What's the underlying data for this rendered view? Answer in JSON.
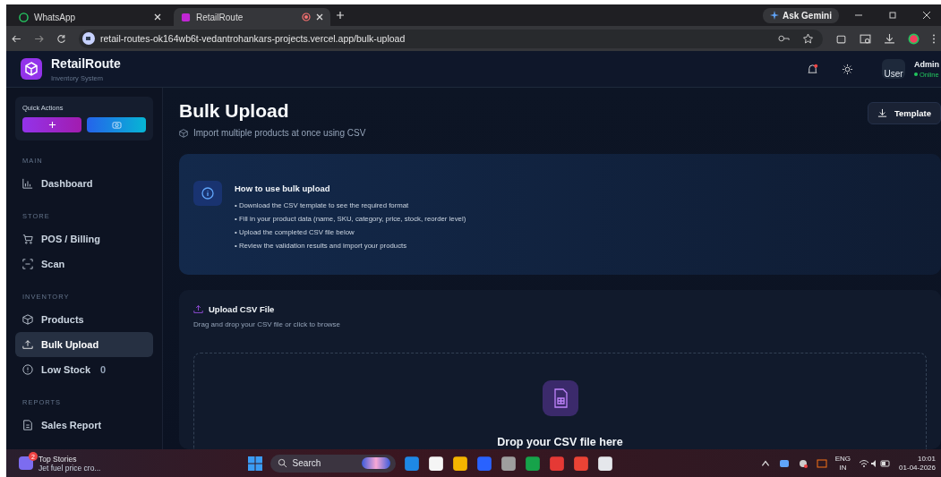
{
  "browser": {
    "tabs": [
      {
        "title": "WhatsApp",
        "selected": false
      },
      {
        "title": "RetailRoute",
        "selected": true
      }
    ],
    "url": "retail-routes-ok164wb6t-vedantrohankars-projects.vercel.app/bulk-upload",
    "gemini": "Ask Gemini"
  },
  "header": {
    "brand": "RetailRoute",
    "subtitle": "Inventory System",
    "user_alt": "User",
    "user_name": "Admin",
    "user_status": "Online",
    "notification": true
  },
  "sidebar": {
    "quick_actions_title": "Quick Actions",
    "sections": [
      {
        "title": "MAIN",
        "items": [
          {
            "label": "Dashboard",
            "selected": false
          }
        ]
      },
      {
        "title": "STORE",
        "items": [
          {
            "label": "POS / Billing",
            "selected": false
          },
          {
            "label": "Scan",
            "selected": false
          }
        ]
      },
      {
        "title": "INVENTORY",
        "items": [
          {
            "label": "Products",
            "selected": false
          },
          {
            "label": "Bulk Upload",
            "selected": true
          },
          {
            "label": "Low Stock",
            "selected": false,
            "count": "0"
          }
        ]
      },
      {
        "title": "REPORTS",
        "items": [
          {
            "label": "Sales Report",
            "selected": false
          }
        ]
      }
    ]
  },
  "page": {
    "title": "Bulk Upload",
    "subtitle": "Import multiple products at once using CSV",
    "template_button": "Template",
    "info": {
      "title": "How to use bulk upload",
      "steps": [
        "• Download the CSV template to see the required format",
        "• Fill in your product data (name, SKU, category, price, stock, reorder level)",
        "• Upload the completed CSV file below",
        "• Review the validation results and import your products"
      ]
    },
    "upload": {
      "title": "Upload CSV File",
      "hint": "Drag and drop your CSV file or click to browse",
      "drop_text": "Drop your CSV file here"
    }
  },
  "taskbar": {
    "news_count": "2",
    "news_title": "Top Stories",
    "news_text": "Jet fuel price cro...",
    "search": "Search",
    "lang_1": "ENG",
    "lang_2": "IN",
    "time": "10:01",
    "date": "01-04-2026"
  }
}
